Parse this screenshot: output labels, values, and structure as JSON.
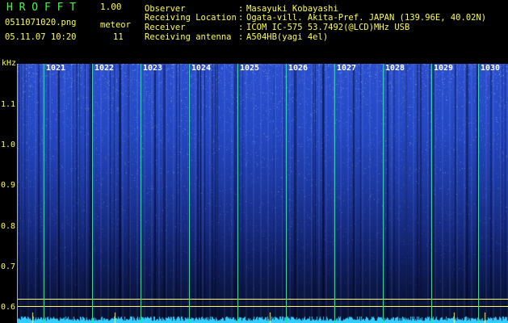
{
  "header": {
    "app_title": "H R O F F T",
    "app_version": "1.00",
    "file_name": "0511071020.png",
    "timestamp": "05.11.07 10:20",
    "meteor_label": "meteor",
    "meteor_count": "11"
  },
  "info": [
    {
      "label": "Observer",
      "value": "Masayuki Kobayashi"
    },
    {
      "label": "Receiving Location",
      "value": "Ogata-vill. Akita-Pref. JAPAN (139.96E, 40.02N)"
    },
    {
      "label": "Receiver",
      "value": "ICOM IC-575 53.7492(@LCD)MHz USB"
    },
    {
      "label": "Receiving antenna",
      "value": "A504HB(yagi 4el)"
    }
  ],
  "axis": {
    "y_unit": "kHz",
    "y_ticks": [
      "1.1",
      "1.0",
      "0.9",
      "0.8",
      "0.7",
      "0.6"
    ],
    "x_ticks": [
      "1021",
      "1022",
      "1023",
      "1024",
      "1025",
      "1026",
      "1027",
      "1028",
      "1029",
      "1030"
    ]
  },
  "colors": {
    "title_green": "#3dff3d",
    "label_yellow": "#ffff44",
    "marker_green": "#00ff66",
    "baseline_cyan": "#33ccff"
  }
}
